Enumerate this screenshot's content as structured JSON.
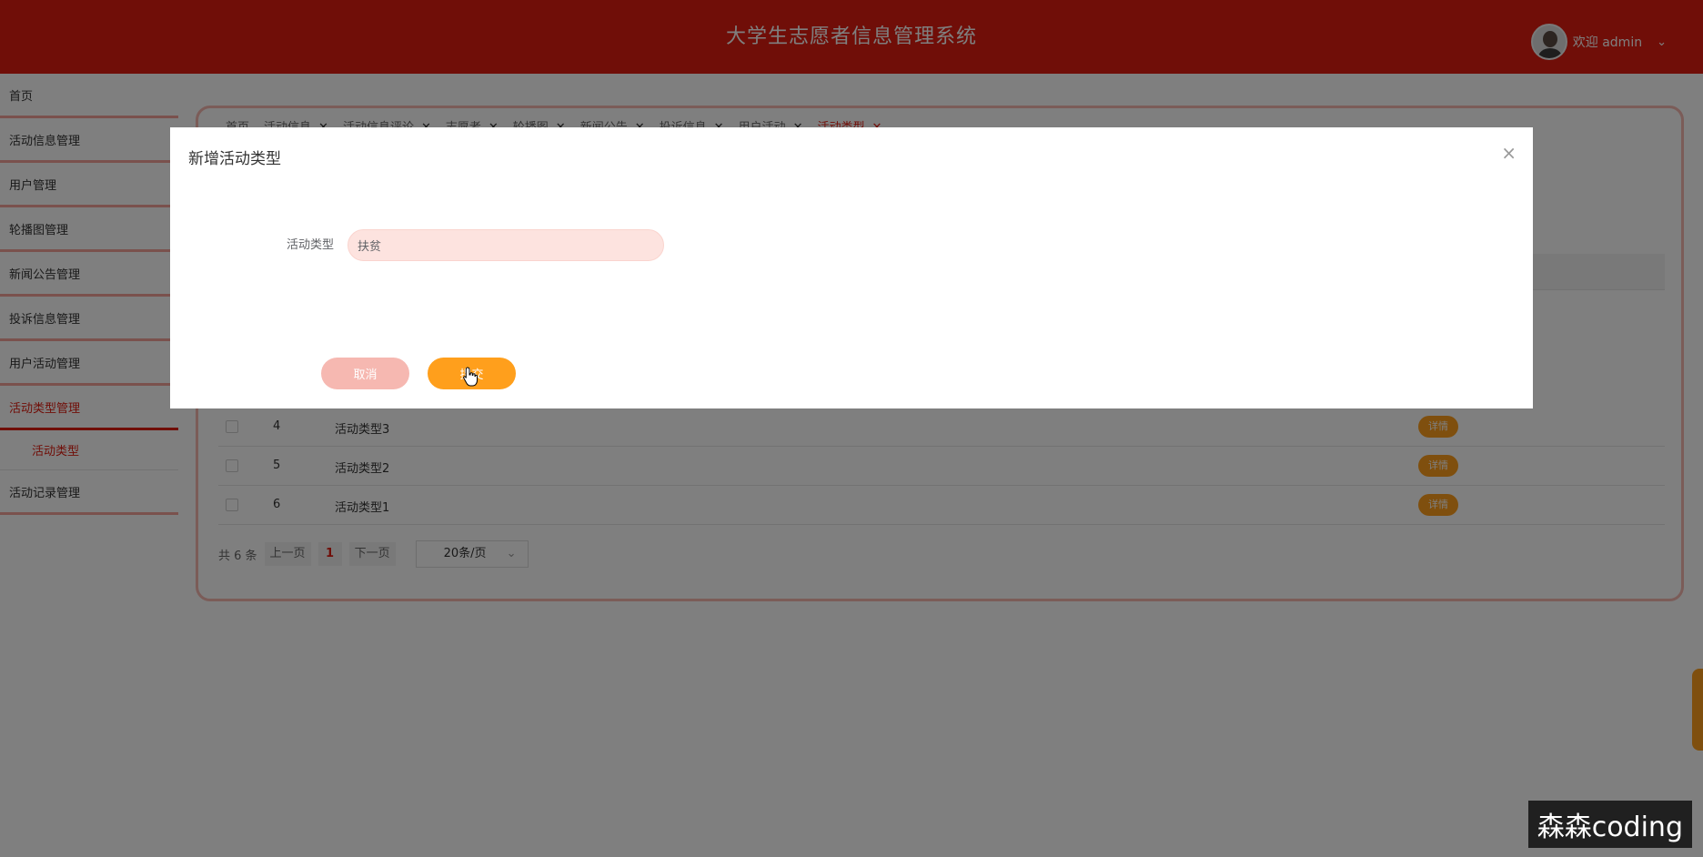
{
  "header": {
    "title": "大学生志愿者信息管理系统",
    "user_greeting": "欢迎 admin",
    "dropdown_icon": "chevron-down-icon"
  },
  "sidebar": {
    "items": [
      {
        "label": "首页"
      },
      {
        "label": "活动信息管理"
      },
      {
        "label": "用户管理"
      },
      {
        "label": "轮播图管理"
      },
      {
        "label": "新闻公告管理"
      },
      {
        "label": "投诉信息管理"
      },
      {
        "label": "用户活动管理"
      },
      {
        "label": "活动类型管理",
        "active": true
      },
      {
        "label": "活动记录管理"
      }
    ],
    "sub_item": {
      "label": "活动类型"
    }
  },
  "tabs": [
    {
      "label": "首页"
    },
    {
      "label": "活动信息"
    },
    {
      "label": "活动信息评论"
    },
    {
      "label": "志愿者"
    },
    {
      "label": "轮播图"
    },
    {
      "label": "新闻公告"
    },
    {
      "label": "投诉信息"
    },
    {
      "label": "用户活动"
    },
    {
      "label": "活动类型",
      "active": true
    }
  ],
  "table": {
    "rows": [
      {
        "num": "4",
        "name": "活动类型3",
        "action": "详情"
      },
      {
        "num": "5",
        "name": "活动类型2",
        "action": "详情"
      },
      {
        "num": "6",
        "name": "活动类型1",
        "action": "详情"
      }
    ]
  },
  "pagination": {
    "total": "共 6 条",
    "prev": "上一页",
    "page": "1",
    "next": "下一页",
    "page_size": "20条/页"
  },
  "modal": {
    "title": "新增活动类型",
    "field_label": "活动类型",
    "field_value": "扶贫",
    "cancel_label": "取消",
    "submit_label": "提交"
  },
  "watermark": "森森coding",
  "colors": {
    "primary": "#e11d10",
    "accent": "#ff9f1c",
    "light": "#f6b8b1"
  }
}
